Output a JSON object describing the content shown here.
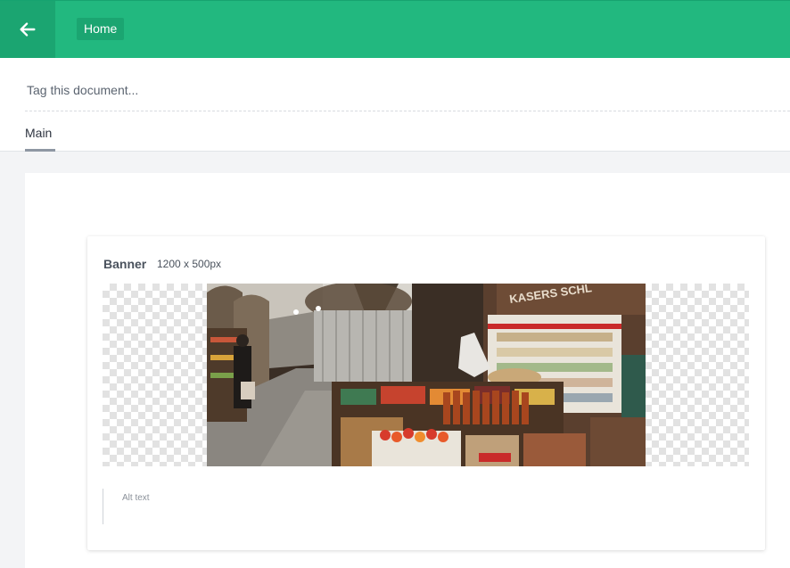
{
  "topbar": {
    "back_icon": "arrow-left-icon",
    "breadcrumb": "Home",
    "accent": "#22b87f"
  },
  "document": {
    "tag_placeholder": "Tag this document...",
    "tabs": [
      {
        "label": "Main",
        "active": true
      }
    ]
  },
  "banner": {
    "title": "Banner",
    "size": "1200 x 500px",
    "image_alt": "Market hall with produce stands and shelves",
    "alt_placeholder": "Alt text"
  }
}
